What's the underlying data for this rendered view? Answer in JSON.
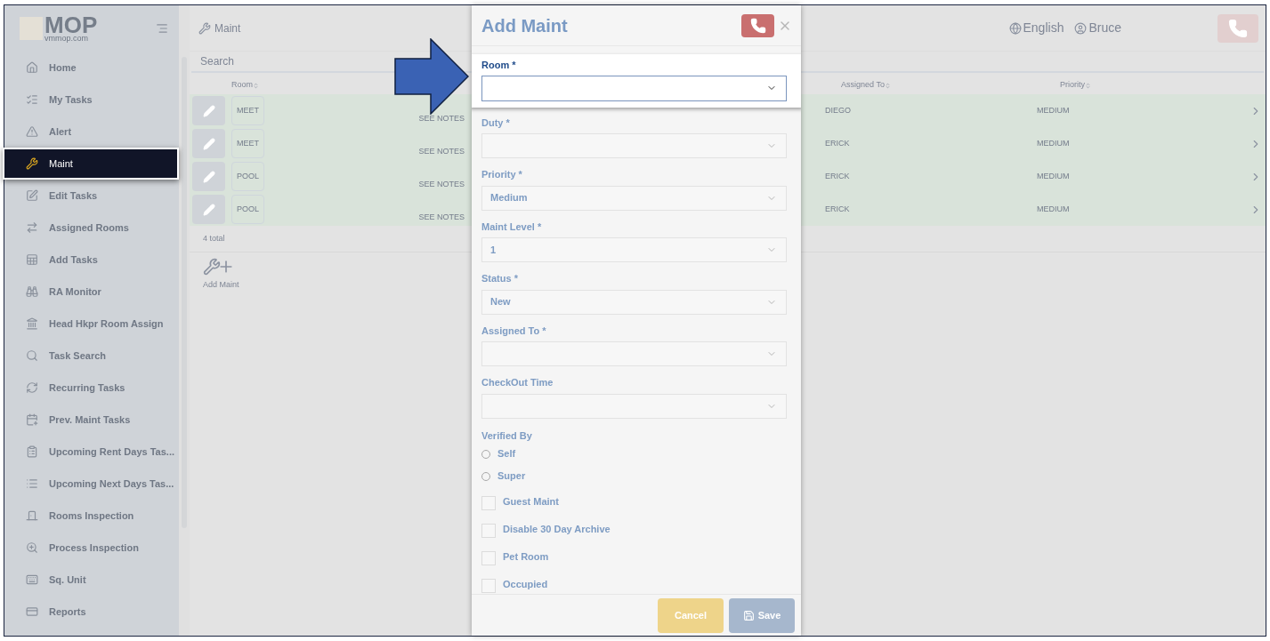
{
  "sidebar": {
    "logo": "MOP",
    "logo_subtitle": "vmmop.com",
    "items": [
      {
        "label": "Home",
        "selected": false
      },
      {
        "label": "My Tasks",
        "selected": false
      },
      {
        "label": "Alert",
        "selected": false
      },
      {
        "label": "Maint",
        "selected": true
      },
      {
        "label": "Edit Tasks",
        "selected": false
      },
      {
        "label": "Assigned Rooms",
        "selected": false
      },
      {
        "label": "Add Tasks",
        "selected": false
      },
      {
        "label": "RA Monitor",
        "selected": false
      },
      {
        "label": "Head Hkpr Room Assign",
        "selected": false
      },
      {
        "label": "Task Search",
        "selected": false
      },
      {
        "label": "Recurring Tasks",
        "selected": false
      },
      {
        "label": "Prev. Maint Tasks",
        "selected": false
      },
      {
        "label": "Upcoming Rent Days Tas...",
        "selected": false
      },
      {
        "label": "Upcoming Next Days Tas...",
        "selected": false
      },
      {
        "label": "Rooms Inspection",
        "selected": false
      },
      {
        "label": "Process Inspection",
        "selected": false
      },
      {
        "label": "Sq. Unit",
        "selected": false
      },
      {
        "label": "Reports",
        "selected": false
      }
    ]
  },
  "header": {
    "page_title": "Maint",
    "language": "English",
    "user": "Bruce"
  },
  "search": {
    "placeholder": "Search"
  },
  "table": {
    "columns": {
      "room": "Room",
      "assigned_to": "Assigned To",
      "priority": "Priority"
    },
    "rows": [
      {
        "room": "MEET",
        "notes": "SEE NOTES",
        "assigned_to": "DIEGO",
        "priority": "MEDIUM"
      },
      {
        "room": "MEET",
        "notes": "SEE NOTES",
        "assigned_to": "ERICK",
        "priority": "MEDIUM"
      },
      {
        "room": "POOL",
        "notes": "SEE NOTES",
        "assigned_to": "ERICK",
        "priority": "MEDIUM"
      },
      {
        "room": "POOL",
        "notes": "SEE NOTES",
        "assigned_to": "ERICK",
        "priority": "MEDIUM"
      }
    ],
    "total": "4 total"
  },
  "add_button": "Add Maint",
  "modal": {
    "title": "Add Maint",
    "fields": [
      {
        "label": "Room *",
        "highlighted": true
      },
      {
        "label": "Duty *",
        "highlighted": false
      },
      {
        "label": "Priority *",
        "value": "Medium",
        "highlighted": false
      },
      {
        "label": "Maint Level *",
        "value": "1",
        "highlighted": false
      },
      {
        "label": "Status *",
        "value": "New",
        "highlighted": false
      },
      {
        "label": "Assigned To *",
        "highlighted": false
      },
      {
        "label": "CheckOut Time",
        "highlighted": false
      }
    ],
    "verified_by": {
      "label": "Verified By",
      "options": [
        {
          "label": "Self",
          "selected": false
        },
        {
          "label": "Super",
          "selected": false
        }
      ]
    },
    "checkboxes": [
      {
        "label": "Guest Maint",
        "checked": false
      },
      {
        "label": "Disable 30 Day Archive",
        "checked": false
      },
      {
        "label": "Pet Room",
        "checked": false
      },
      {
        "label": "Occupied",
        "checked": false
      }
    ],
    "cancel": "Cancel",
    "save": "Save"
  }
}
